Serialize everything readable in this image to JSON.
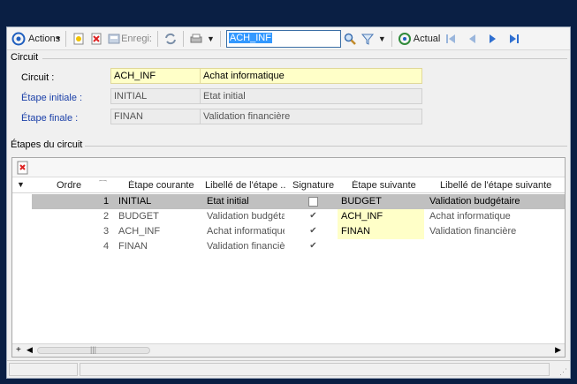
{
  "toolbar": {
    "actions_label": "Actions",
    "save_label": "Enregi:",
    "search_value": "ACH_INF",
    "refresh_label": "Actual",
    "icons": [
      "target-icon",
      "new-icon",
      "delete-icon",
      "save-icon",
      "refresh-icon",
      "print-icon",
      "dropdown-icon",
      "search-icon",
      "filter-icon",
      "dropdown-icon",
      "actualize-icon",
      "first-icon",
      "previous-icon",
      "next-icon",
      "last-icon"
    ]
  },
  "circuit": {
    "section_title": "Circuit",
    "circuit_label": "Circuit :",
    "circuit_code": "ACH_INF",
    "circuit_name": "Achat informatique",
    "start_label": "Étape initiale :",
    "start_code": "INITIAL",
    "start_name": "Etat initial",
    "end_label": "Étape finale :",
    "end_code": "FINAN",
    "end_name": "Validation financière"
  },
  "steps": {
    "section_title": "Étapes du circuit",
    "columns": [
      "Ordre",
      "Étape courante",
      "Libellé de l'étape ...",
      "Signature",
      "Étape suivante",
      "Libellé de l'étape suivante"
    ],
    "rows": [
      {
        "order": "1",
        "current": "INITIAL",
        "label": "Etat initial",
        "signature": false,
        "next": "BUDGET",
        "next_label": "Validation budgétaire"
      },
      {
        "order": "2",
        "current": "BUDGET",
        "label": "Validation budgéta",
        "signature": true,
        "next": "ACH_INF",
        "next_label": "Achat informatique"
      },
      {
        "order": "3",
        "current": "ACH_INF",
        "label": "Achat informatique",
        "signature": true,
        "next": "FINAN",
        "next_label": "Validation financière"
      },
      {
        "order": "4",
        "current": "FINAN",
        "label": "Validation financiè",
        "signature": true,
        "next": "",
        "next_label": ""
      }
    ]
  },
  "colors": {
    "desktop": "#0a1f44",
    "field_yellow": "#ffffc8",
    "selected_row": "#c0c0c0",
    "link_blue": "#1a3fa8"
  }
}
